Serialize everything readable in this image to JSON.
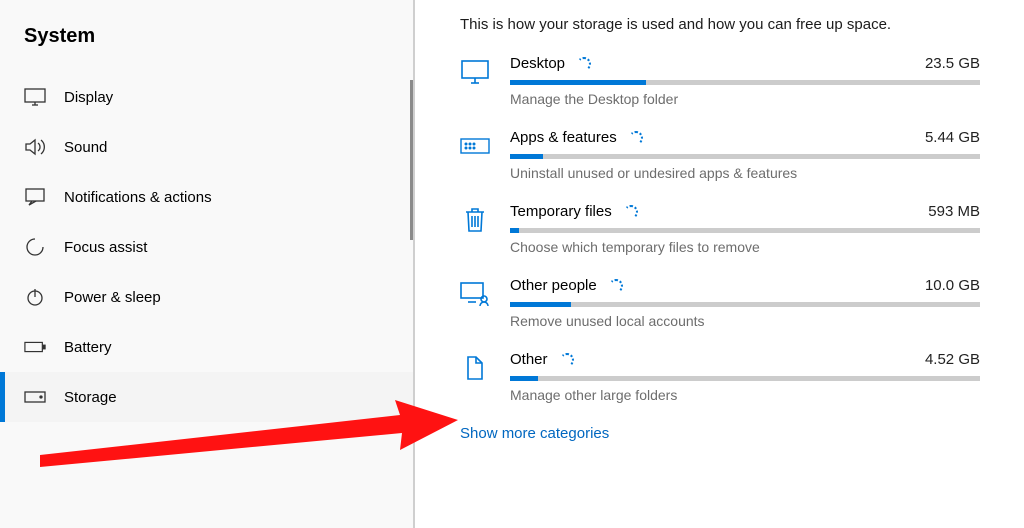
{
  "sidebar": {
    "title": "System",
    "items": [
      {
        "label": "Display"
      },
      {
        "label": "Sound"
      },
      {
        "label": "Notifications & actions"
      },
      {
        "label": "Focus assist"
      },
      {
        "label": "Power & sleep"
      },
      {
        "label": "Battery"
      },
      {
        "label": "Storage"
      }
    ]
  },
  "main": {
    "intro": "This is how your storage is used and how you can free up space.",
    "categories": [
      {
        "title": "Desktop",
        "size": "23.5 GB",
        "desc": "Manage the Desktop folder",
        "fill_pct": 29
      },
      {
        "title": "Apps & features",
        "size": "5.44 GB",
        "desc": "Uninstall unused or undesired apps & features",
        "fill_pct": 7
      },
      {
        "title": "Temporary files",
        "size": "593 MB",
        "desc": "Choose which temporary files to remove",
        "fill_pct": 2
      },
      {
        "title": "Other people",
        "size": "10.0 GB",
        "desc": "Remove unused local accounts",
        "fill_pct": 13
      },
      {
        "title": "Other",
        "size": "4.52 GB",
        "desc": "Manage other large folders",
        "fill_pct": 6
      }
    ],
    "show_more": "Show more categories"
  }
}
